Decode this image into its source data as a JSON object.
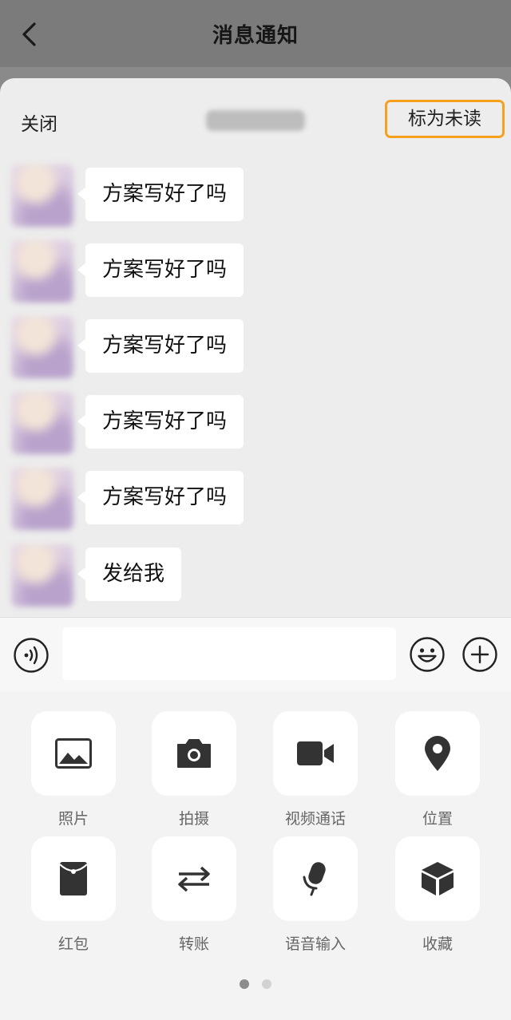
{
  "header": {
    "title": "消息通知"
  },
  "sheet": {
    "close_label": "关闭",
    "mark_unread_label": "标为未读"
  },
  "messages": [
    {
      "text": "方案写好了吗"
    },
    {
      "text": "方案写好了吗"
    },
    {
      "text": "方案写好了吗"
    },
    {
      "text": "方案写好了吗"
    },
    {
      "text": "方案写好了吗"
    },
    {
      "text": "发给我"
    }
  ],
  "input_bar": {
    "value": "",
    "placeholder": ""
  },
  "panel": {
    "items": [
      {
        "label": "照片",
        "icon": "photo-icon"
      },
      {
        "label": "拍摄",
        "icon": "camera-icon"
      },
      {
        "label": "视频通话",
        "icon": "video-call-icon"
      },
      {
        "label": "位置",
        "icon": "location-icon"
      },
      {
        "label": "红包",
        "icon": "red-packet-icon"
      },
      {
        "label": "转账",
        "icon": "transfer-icon"
      },
      {
        "label": "语音输入",
        "icon": "microphone-icon"
      },
      {
        "label": "收藏",
        "icon": "favorites-icon"
      }
    ],
    "page_count": 2,
    "current_page": 1
  },
  "colors": {
    "accent_highlight": "#f5a11d",
    "icon_dark": "#333333",
    "dot_active": "#8c8c8c",
    "dot_inactive": "#d2d2d2"
  }
}
